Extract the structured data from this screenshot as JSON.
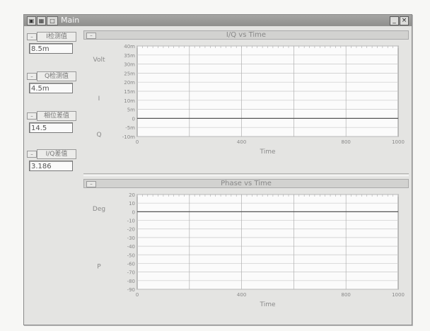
{
  "window": {
    "title": "Main",
    "icons": [
      "app-icon",
      "grid-icon",
      "window-icon"
    ],
    "controls": [
      "minimize-icon",
      "close-icon"
    ]
  },
  "indicators": [
    {
      "label": "I检测值",
      "value": "8.5m"
    },
    {
      "label": "Q检测值",
      "value": "4.5m"
    },
    {
      "label": "相位差值",
      "value": "14.5"
    },
    {
      "label": "I/Q差值",
      "value": "3.186"
    }
  ],
  "graphs": [
    {
      "title": "I/Q vs Time",
      "ylabel_unit": "Volt",
      "legend": [
        "I",
        "Q"
      ],
      "x_ticks": [
        "0",
        "400",
        "800",
        "1000"
      ],
      "x_label": "Time",
      "y_ticks": [
        "40m",
        "35m",
        "30m",
        "25m",
        "20m",
        "15m",
        "10m",
        "5m",
        "0",
        "-5m",
        "-10m"
      ]
    },
    {
      "title": "Phase vs Time",
      "ylabel_unit": "Deg",
      "legend": [
        "P"
      ],
      "x_ticks": [
        "0",
        "400",
        "800",
        "1000"
      ],
      "x_label": "Time",
      "y_ticks": [
        "20",
        "10",
        "0",
        "-10",
        "-20",
        "-30",
        "-40",
        "-50",
        "-60",
        "-70",
        "-80",
        "-90"
      ]
    }
  ],
  "colors": {
    "plot_bg": "#fbfbfb",
    "grid": "#c8c8c8",
    "trace": "#555555"
  },
  "chart_data": [
    {
      "type": "line",
      "title": "I/Q vs Time",
      "xlabel": "Time",
      "ylabel": "Volt",
      "xlim": [
        0,
        1000
      ],
      "ylim": [
        -10,
        40
      ],
      "y_unit": "m",
      "grid": true,
      "series": [
        {
          "name": "I",
          "x": [
            0,
            1000
          ],
          "values": [
            0,
            0
          ]
        }
      ]
    },
    {
      "type": "line",
      "title": "Phase vs Time",
      "xlabel": "Time",
      "ylabel": "Deg",
      "xlim": [
        0,
        1000
      ],
      "ylim": [
        -90,
        20
      ],
      "grid": true,
      "series": [
        {
          "name": "P",
          "x": [
            0,
            1000
          ],
          "values": [
            0,
            0
          ]
        }
      ]
    }
  ]
}
